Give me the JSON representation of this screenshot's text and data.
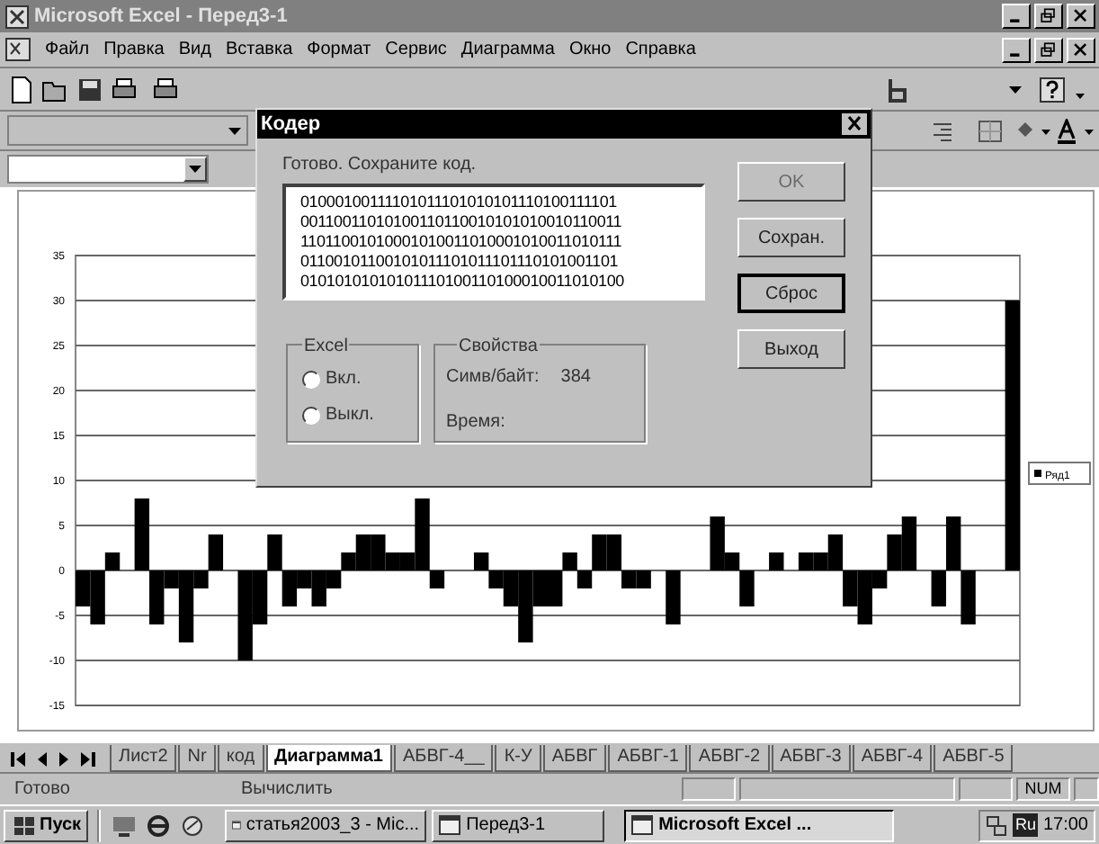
{
  "window": {
    "title": "Microsoft Excel - Перед3-1"
  },
  "menu": [
    "Файл",
    "Правка",
    "Вид",
    "Вставка",
    "Формат",
    "Сервис",
    "Диаграмма",
    "Окно",
    "Справка"
  ],
  "chart_data": {
    "type": "bar",
    "grid": true,
    "ylim": [
      -15,
      35
    ],
    "yticks": [
      -15,
      -10,
      -5,
      0,
      5,
      10,
      15,
      20,
      25,
      30,
      35
    ],
    "series": [
      {
        "name": "Ряд1",
        "color": "#000000",
        "values": [
          -4,
          -6,
          2,
          0,
          8,
          -6,
          -2,
          -8,
          -2,
          4,
          0,
          -10,
          -6,
          4,
          -4,
          -2,
          -4,
          -2,
          2,
          4,
          4,
          2,
          2,
          8,
          -2,
          0,
          0,
          2,
          -2,
          -4,
          -8,
          -4,
          -4,
          2,
          -2,
          4,
          4,
          -2,
          -2,
          0,
          -6,
          0,
          0,
          6,
          2,
          -4,
          0,
          2,
          0,
          2,
          2,
          4,
          -4,
          -6,
          -2,
          4,
          6,
          0,
          -4,
          6,
          -6,
          0,
          0,
          30
        ]
      }
    ]
  },
  "dialog": {
    "title": "Кодер",
    "message": "Готово. Сохраните код.",
    "code_lines": [
      "01000100111101011101010101110100111101",
      "00110011010100110110010101010010110011",
      "11011001010001010011010001010011010111",
      "01100101100101011101011101110101001101",
      "01010101010101110100110100010011010100"
    ],
    "buttons": [
      {
        "label": "OK",
        "disabled": true,
        "focused": false
      },
      {
        "label": "Сохран.",
        "disabled": false,
        "focused": false
      },
      {
        "label": "Сброс",
        "disabled": false,
        "focused": true
      },
      {
        "label": "Выход",
        "disabled": false,
        "focused": false
      }
    ],
    "excel_group": {
      "title": "Excel",
      "options": [
        {
          "label": "Вкл.",
          "selected": false
        },
        {
          "label": "Выкл.",
          "selected": false
        }
      ]
    },
    "properties": {
      "title": "Свойства",
      "rows": [
        {
          "label": "Симв/байт:",
          "value": "384"
        },
        {
          "label": "Время:"
        }
      ]
    }
  },
  "sheet_tabs": [
    {
      "label": "Лист2",
      "selected": false
    },
    {
      "label": "Nr",
      "selected": false
    },
    {
      "label": "код",
      "selected": false
    },
    {
      "label": "Диаграмма1",
      "selected": true
    },
    {
      "label": "АБВГ-4__",
      "selected": false
    },
    {
      "label": "К-У",
      "selected": false
    },
    {
      "label": "АБВГ",
      "selected": false
    },
    {
      "label": "АБВГ-1",
      "selected": false
    },
    {
      "label": "АБВГ-2",
      "selected": false
    },
    {
      "label": "АБВГ-3",
      "selected": false
    },
    {
      "label": "АБВГ-4",
      "selected": false
    },
    {
      "label": "АБВГ-5",
      "selected": false
    }
  ],
  "status_bar": {
    "left": "Готово",
    "middle": "Вычислить",
    "indicator": "NUM"
  },
  "taskbar": {
    "start": "Пуск",
    "items": [
      {
        "label": "статья2003_3 - Mic...",
        "selected": false
      },
      {
        "label": "Перед3-1",
        "selected": false
      },
      {
        "label": "Microsoft Excel ...",
        "selected": true
      }
    ],
    "language": "Ru",
    "clock": "17:00"
  }
}
